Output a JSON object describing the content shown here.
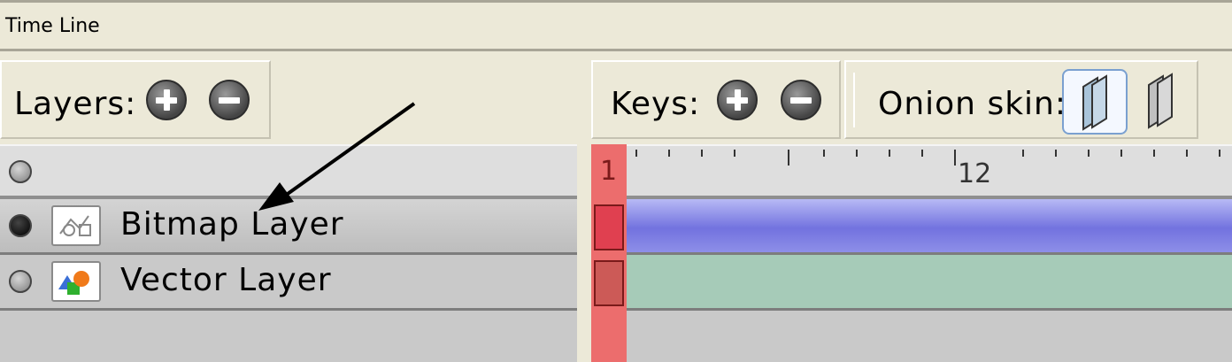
{
  "window": {
    "title": "Time Line"
  },
  "layers_toolbar": {
    "label": "Layers:",
    "add_icon": "plus-circle-icon",
    "remove_icon": "minus-circle-icon"
  },
  "keys_toolbar": {
    "label": "Keys:",
    "add_icon": "plus-circle-icon",
    "remove_icon": "minus-circle-icon"
  },
  "onion_skin": {
    "label": "Onion skin:",
    "icons": [
      "onion-skin-previous-icon",
      "onion-skin-next-icon"
    ],
    "selected_index": 0
  },
  "layers": [
    {
      "name": "Bitmap Layer",
      "type": "bitmap",
      "icon": "bitmap-layer-icon",
      "visible": true,
      "selected": true
    },
    {
      "name": "Vector Layer",
      "type": "vector",
      "icon": "vector-layer-icon",
      "visible": false,
      "selected": false
    }
  ],
  "timeline": {
    "current_frame": "1",
    "ruler_labels": [
      "1",
      "12"
    ]
  },
  "colors": {
    "playhead": "#ec6d6d",
    "bitmap_track": "#7272df",
    "vector_track": "#a6cbb8",
    "keyframe": "#e04050"
  }
}
